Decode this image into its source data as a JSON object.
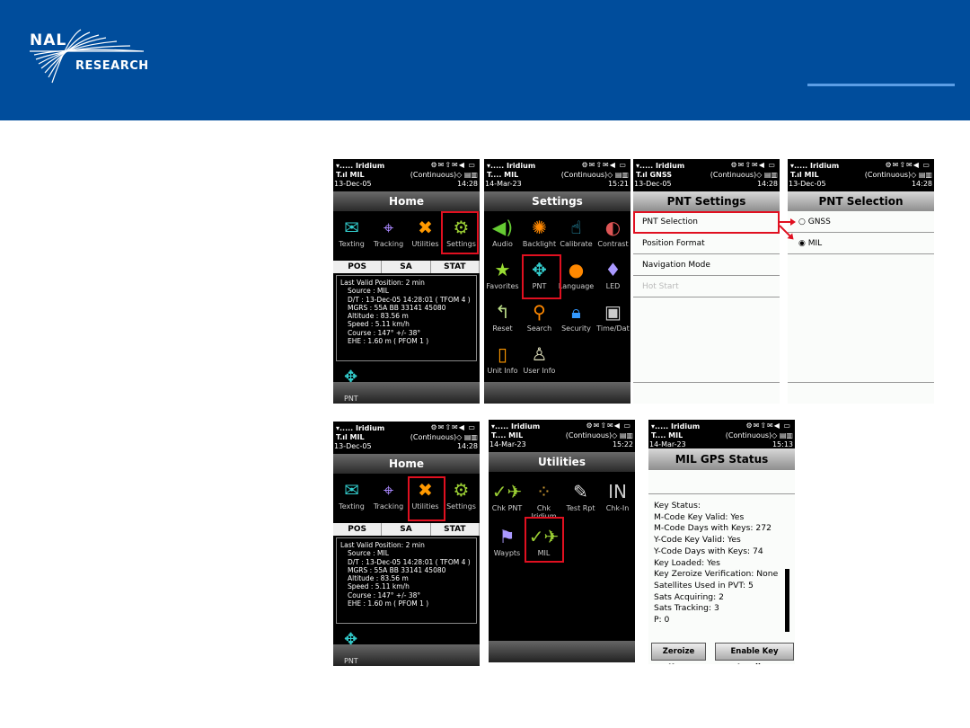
{
  "header": {
    "brand_top": "NAL",
    "brand_bottom": "RESEARCH"
  },
  "colors": {
    "banner": "#004d9c",
    "highlight": "#e01020"
  },
  "status": {
    "net1": "▾..... Iridium",
    "icons": "⚙✉⇧✉◀ ▭",
    "mode": "(Continuous)◇ ▤▥"
  },
  "home1": {
    "status": {
      "net2": "T.ıl MIL",
      "date": "13-Dec-05",
      "time": "14:28"
    },
    "title": "Home",
    "apps": [
      {
        "label": "Texting",
        "icon": "✉",
        "color": "#3cc"
      },
      {
        "label": "Tracking",
        "icon": "⌖",
        "color": "#a8f"
      },
      {
        "label": "Utilities",
        "icon": "✖",
        "color": "#f90"
      },
      {
        "label": "Settings",
        "icon": "⚙",
        "color": "#9c3"
      }
    ],
    "tabs": [
      "POS",
      "SA",
      "STAT"
    ],
    "position": {
      "head": "Last Valid Position:  2 min",
      "lines": [
        "Source :  MIL",
        "D/T :  13-Dec-05 14:28:01  ( TFOM 4 )",
        "MGRS :  55A BB 33141 45080",
        "Altitude :  83.56 m",
        "Speed :  5.11 km/h",
        "Course :  147° +/- 38°",
        "EHE :  1.60 m  ( PFOM 1 )"
      ]
    },
    "footer": "PNT"
  },
  "settings": {
    "status": {
      "net2": "T.... MIL",
      "date": "14-Mar-23",
      "time": "15:21"
    },
    "title": "Settings",
    "apps": [
      {
        "label": "Audio",
        "icon": "◀)",
        "color": "#6c3"
      },
      {
        "label": "Backlight",
        "icon": "✺",
        "color": "#f80"
      },
      {
        "label": "Calibrate",
        "icon": "☝",
        "color": "#3bd"
      },
      {
        "label": "Contrast",
        "icon": "◐",
        "color": "#d55"
      },
      {
        "label": "Favorites",
        "icon": "★",
        "color": "#9d3"
      },
      {
        "label": "PNT",
        "icon": "✥",
        "color": "#3cc"
      },
      {
        "label": "Language",
        "icon": "●",
        "color": "#f80"
      },
      {
        "label": "LED",
        "icon": "♦",
        "color": "#a9f"
      },
      {
        "label": "Reset",
        "icon": "↰",
        "color": "#bd8"
      },
      {
        "label": "Search",
        "icon": "⚲",
        "color": "#f80"
      },
      {
        "label": "Security",
        "icon": "🔒︎",
        "color": "#39f"
      },
      {
        "label": "Time/Dat",
        "icon": "▣",
        "color": "#ccc"
      },
      {
        "label": "Unit Info",
        "icon": "▯",
        "color": "#f90"
      },
      {
        "label": "User Info",
        "icon": "♙",
        "color": "#ddb"
      }
    ]
  },
  "pnt_settings": {
    "status": {
      "net2": "T.ıl GNSS",
      "date": "13-Dec-05",
      "time": "14:28"
    },
    "title": "PNT Settings",
    "items": [
      {
        "label": "PNT Selection",
        "disabled": false
      },
      {
        "label": "Position Format",
        "disabled": false
      },
      {
        "label": "Navigation Mode",
        "disabled": false
      },
      {
        "label": "Hot Start",
        "disabled": true
      }
    ]
  },
  "pnt_selection": {
    "status": {
      "net2": "T.ıl MIL",
      "date": "13-Dec-05",
      "time": "14:28"
    },
    "title": "PNT Selection",
    "options": [
      {
        "label": "○ GNSS",
        "selected": false
      },
      {
        "label": "◉ MIL",
        "selected": true
      }
    ]
  },
  "home2": {
    "status": {
      "net2": "T.ıl MIL",
      "date": "13-Dec-05",
      "time": "14:28"
    },
    "title": "Home"
  },
  "utilities": {
    "status": {
      "net2": "T.... MIL",
      "date": "14-Mar-23",
      "time": "15:22"
    },
    "title": "Utilities",
    "apps": [
      {
        "label": "Chk PNT",
        "icon": "✓✈",
        "color": "#9c3"
      },
      {
        "label": "Chk Iridium",
        "icon": "⁘",
        "color": "#c93"
      },
      {
        "label": "Test Rpt",
        "icon": "✎",
        "color": "#ddd"
      },
      {
        "label": "Chk-In",
        "icon": "IN",
        "color": "#ccc"
      },
      {
        "label": "Waypts",
        "icon": "⚑",
        "color": "#a9f"
      },
      {
        "label": "MIL",
        "icon": "✓✈",
        "color": "#9c3"
      }
    ]
  },
  "mil_gps": {
    "status": {
      "net2": "T.... MIL",
      "date": "14-Mar-23",
      "time": "15:13"
    },
    "title": "MIL GPS Status",
    "lines": [
      "Key Status:",
      "M-Code Key Valid: Yes",
      "M-Code Days with Keys: 272",
      "Y-Code Key Valid: Yes",
      "Y-Code Days with Keys: 74",
      "Key Loaded: Yes",
      "Key Zeroize Verification: None",
      "Satellites Used in PVT: 5",
      "Sats Acquiring: 2",
      "Sats Tracking: 3",
      "P: 0"
    ],
    "buttons": {
      "zeroize": "Zeroize Keys",
      "enable": "Enable Key Loading"
    }
  }
}
